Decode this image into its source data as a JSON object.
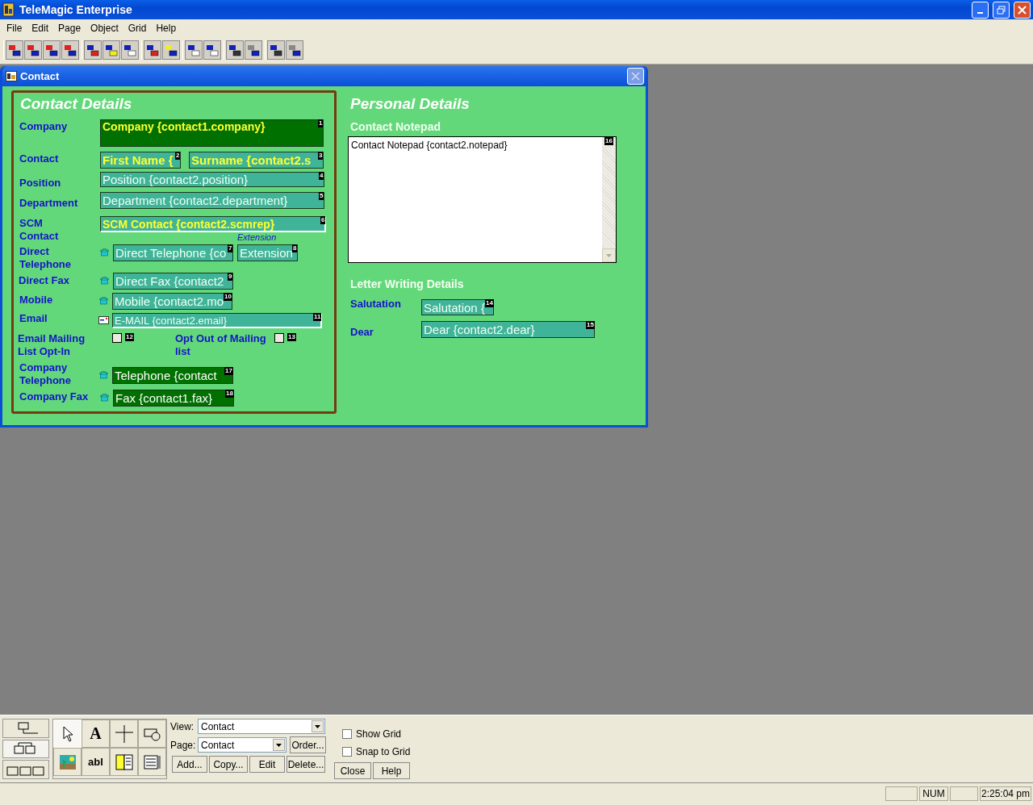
{
  "app": {
    "title": "TeleMagic Enterprise"
  },
  "menu": [
    "File",
    "Edit",
    "Page",
    "Object",
    "Grid",
    "Help"
  ],
  "toolbar": [
    {
      "kind": "align_left"
    },
    {
      "kind": "align_right"
    },
    {
      "kind": "align_top"
    },
    {
      "kind": "align_bottom"
    },
    {
      "kind": "same_height"
    },
    {
      "kind": "same_width"
    },
    {
      "kind": "same_size"
    },
    {
      "kind": "center_h"
    },
    {
      "kind": "center_v"
    },
    {
      "kind": "space_h"
    },
    {
      "kind": "space_v"
    },
    {
      "kind": "front"
    },
    {
      "kind": "back"
    },
    {
      "kind": "edit_color"
    },
    {
      "kind": "edit_gray"
    }
  ],
  "form_window": {
    "title": "Contact",
    "contact_details": {
      "heading": "Contact Details",
      "labels": [
        "Company",
        "Contact",
        "Position",
        "Department",
        "SCM Contact",
        "Direct Telephone",
        "Direct Fax",
        "Mobile",
        "Email",
        "Email Mailing List Opt-In",
        "Company Telephone",
        "Company Fax"
      ],
      "extension_caption": "Extension",
      "fields": [
        {
          "text": "Company {contact1.company}",
          "number": "1",
          "kind": "company"
        },
        {
          "text": "First Name {",
          "number": "2",
          "kind": "name"
        },
        {
          "text": "Surname {contact2.s",
          "number": "3",
          "kind": "name"
        },
        {
          "text": "Position {contact2.position}",
          "number": "4",
          "kind": "text"
        },
        {
          "text": "Department {contact2.department}",
          "number": "5",
          "kind": "text"
        },
        {
          "text": "SCM Contact {contact2.scmrep}",
          "number": "6",
          "kind": "lookup"
        },
        {
          "text": "Direct Telephone {co",
          "number": "7",
          "kind": "phone"
        },
        {
          "text": "Extension",
          "number": "8",
          "kind": "text"
        },
        {
          "text": "Direct Fax {contact2",
          "number": "9",
          "kind": "phone"
        },
        {
          "text": "Mobile {contact2.mo",
          "number": "10",
          "kind": "phone"
        },
        {
          "text": "E-MAIL {contact2.email}",
          "number": "11",
          "kind": "email"
        },
        {
          "text": "Telephone {contact",
          "number": "17",
          "kind": "company_phone"
        },
        {
          "text": "Fax {contact1.fax}",
          "number": "18",
          "kind": "company_phone"
        }
      ],
      "checkboxes": [
        {
          "number": "12",
          "checked": false
        },
        {
          "number": "13",
          "checked": false,
          "label": "Opt Out of Mailing list"
        }
      ]
    },
    "personal_details": {
      "heading": "Personal Details",
      "notepad": {
        "label": "Contact Notepad",
        "text": "Contact Notepad {contact2.notepad}",
        "number": "16"
      },
      "letter_heading": "Letter Writing Details",
      "labels": [
        "Salutation",
        "Dear"
      ],
      "fields": [
        {
          "text": "Salutation {",
          "number": "14",
          "kind": "text"
        },
        {
          "text": "Dear {contact2.dear}",
          "number": "15",
          "kind": "text"
        }
      ]
    }
  },
  "designer": {
    "tools": [
      {
        "kind": "pointer",
        "selected": true
      },
      {
        "kind": "text",
        "glyph": "A",
        "selected": false
      },
      {
        "kind": "line",
        "selected": false
      },
      {
        "kind": "shape",
        "selected": false
      },
      {
        "kind": "picture",
        "selected": false
      },
      {
        "kind": "text",
        "glyph": "abl",
        "selected": false
      },
      {
        "kind": "list",
        "selected": false
      },
      {
        "kind": "grid",
        "selected": false
      }
    ],
    "view": {
      "label": "View:",
      "value": "Contact"
    },
    "page": {
      "label": "Page:",
      "value": "Contact"
    },
    "order_button": "Order...",
    "buttons": [
      "Add...",
      "Copy...",
      "Edit",
      "Delete..."
    ],
    "options": [
      {
        "label": "Show Grid",
        "checked": false
      },
      {
        "label": "Snap to Grid",
        "checked": false
      }
    ],
    "close_buttons": [
      "Close",
      "Help"
    ]
  },
  "status_bar": [
    {
      "kind": "blank"
    },
    {
      "kind": "text",
      "text": "NUM"
    },
    {
      "kind": "blank"
    },
    {
      "kind": "text",
      "text": "2:25:04 pm"
    }
  ]
}
